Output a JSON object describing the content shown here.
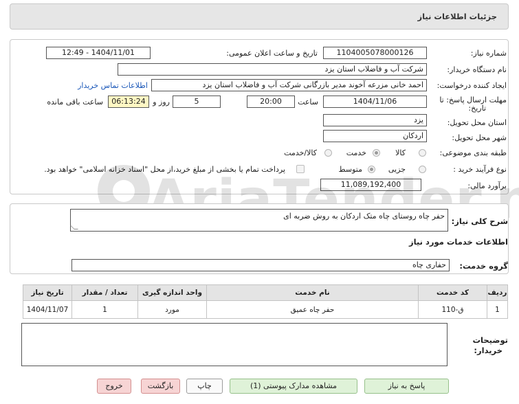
{
  "header": {
    "title": "جزئیات اطلاعات نیاز"
  },
  "form": {
    "need_number_label": "شماره نیاز:",
    "need_number": "1104005078000126",
    "announce_label": "تاریخ و ساعت اعلان عمومی:",
    "announce_value": "1404/11/01 - 12:49",
    "buyer_org_label": "نام دستگاه خریدار:",
    "buyer_org": "شرکت آب و فاضلاب استان یزد",
    "requester_label": "ایجاد کننده درخواست:",
    "requester": "احمد خانی مزرعه آخوند مدیر بازرگانی شرکت آب و فاضلاب استان یزد",
    "contact_link": "اطلاعات تماس خریدار",
    "deadline_label_1": "مهلت ارسال پاسخ: تا",
    "deadline_label_2": "تاریخ:",
    "deadline_date": "1404/11/06",
    "time_label": "ساعت",
    "deadline_time": "20:00",
    "days_value": "5",
    "days_label": "روز و",
    "remaining_time": "06:13:24",
    "remaining_label": "ساعت باقی مانده",
    "province_label": "استان محل تحویل:",
    "province": "یزد",
    "city_label": "شهر محل تحویل:",
    "city": "اردکان",
    "category_label": "طبقه بندی موضوعی:",
    "category_options": [
      "کالا",
      "خدمت",
      "کالا/خدمت"
    ],
    "category_selected": "خدمت",
    "process_label": "نوع فرآیند خرید :",
    "process_options": [
      "جزیی",
      "متوسط"
    ],
    "process_selected": "متوسط",
    "treasury_note": "پرداخت تمام یا بخشی از مبلغ خرید،از محل \"اسناد خزانه اسلامی\" خواهد بود.",
    "budget_label": "برآورد مالی:",
    "budget": "11,089,192,400"
  },
  "summary": {
    "label": "شرح کلی نیاز:",
    "text": "حفر چاه روستای چاه متک اردکان به روش ضربه ای"
  },
  "services": {
    "section_title": "اطلاعات خدمات مورد نیاز",
    "group_label": "گروه خدمت:",
    "group_value": "حفاری چاه",
    "columns": [
      "ردیف",
      "کد خدمت",
      "نام خدمت",
      "واحد اندازه گیری",
      "تعداد / مقدار",
      "تاریخ نیاز"
    ],
    "rows": [
      [
        "1",
        "ق-110",
        "حفر چاه عمیق",
        "مورد",
        "1",
        "1404/11/07"
      ]
    ]
  },
  "buyer_notes": {
    "label_1": "توضیحات",
    "label_2": "خریدار:",
    "value": ""
  },
  "buttons": {
    "reply": "پاسخ به نیاز",
    "view_docs": "مشاهده مدارک پیوستی (1)",
    "print": "چاپ",
    "back": "بازگشت",
    "exit": "خروج"
  },
  "watermark": "AriaTender.neT",
  "colors": {
    "link": "#1a57b8",
    "green_button": "#dff2d8",
    "red_button": "#f7d4d4",
    "timer_bg": "#fff8c4"
  }
}
